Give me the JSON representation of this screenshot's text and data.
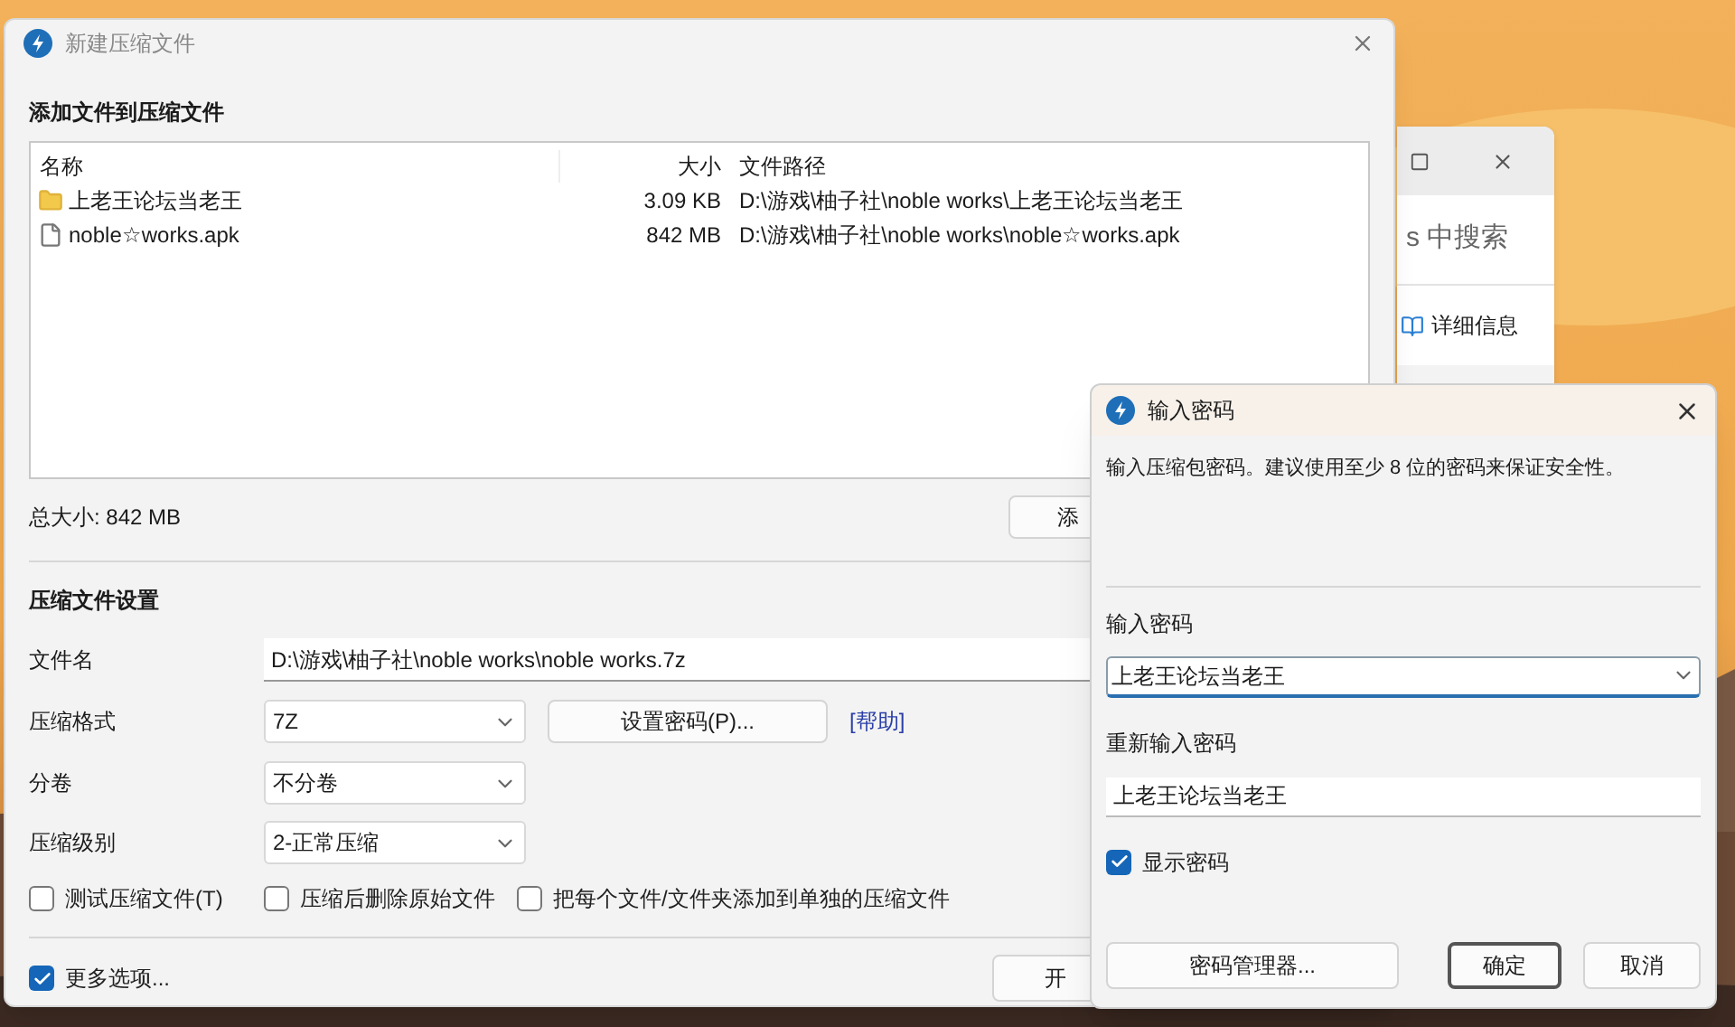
{
  "back_window": {
    "search_text": "s 中搜索",
    "details_label": "详细信息"
  },
  "main_window": {
    "title": "新建压缩文件",
    "files_section": {
      "heading": "添加文件到压缩文件",
      "columns": [
        "名称",
        "大小",
        "文件路径"
      ],
      "rows": [
        {
          "kind": "folder",
          "name": "上老王论坛当老王",
          "size": "3.09 KB",
          "path": "D:\\游戏\\柚子社\\noble works\\上老王论坛当老王"
        },
        {
          "kind": "file",
          "name": "noble☆works.apk",
          "size": "842 MB",
          "path": "D:\\游戏\\柚子社\\noble works\\noble☆works.apk"
        }
      ]
    },
    "total_size": "总大小: 842 MB",
    "add_button": "添",
    "settings": {
      "heading": "压缩文件设置",
      "filename_label": "文件名",
      "filename_value": "D:\\游戏\\柚子社\\noble works\\noble works.7z",
      "format_label": "压缩格式",
      "format_value": "7Z",
      "set_password_button": "设置密码(P)...",
      "help_link": "[帮助]",
      "split_label": "分卷",
      "split_value": "不分卷",
      "level_label": "压缩级别",
      "level_value": "2-正常压缩"
    },
    "options": [
      {
        "label": "测试压缩文件(T)",
        "checked": false
      },
      {
        "label": "压缩后删除原始文件",
        "checked": false
      },
      {
        "label": "把每个文件/文件夹添加到单独的压缩文件",
        "checked": false
      }
    ],
    "more_options": {
      "label": "更多选项...",
      "checked": true
    },
    "start_button": "开"
  },
  "password_dialog": {
    "title": "输入密码",
    "description": "输入压缩包密码。建议使用至少 8 位的密码来保证安全性。",
    "password_label": "输入密码",
    "password_value": "上老王论坛当老王",
    "confirm_label": "重新输入密码",
    "confirm_value": "上老王论坛当老王",
    "show_password": {
      "label": "显示密码",
      "checked": true
    },
    "buttons": [
      {
        "label": "密码管理器...",
        "default": false
      },
      {
        "label": "确定",
        "default": true
      },
      {
        "label": "取消",
        "default": false
      }
    ]
  }
}
